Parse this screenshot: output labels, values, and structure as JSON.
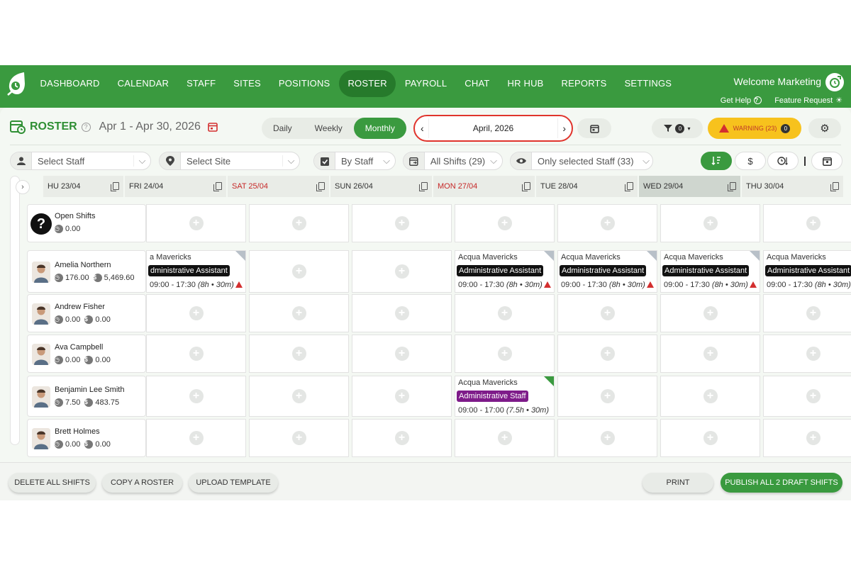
{
  "nav": {
    "items": [
      {
        "label": "DASHBOARD",
        "active": false
      },
      {
        "label": "CALENDAR",
        "active": false
      },
      {
        "label": "STAFF",
        "active": false
      },
      {
        "label": "SITES",
        "active": false
      },
      {
        "label": "POSITIONS",
        "active": false
      },
      {
        "label": "ROSTER",
        "active": true
      },
      {
        "label": "PAYROLL",
        "active": false
      },
      {
        "label": "CHAT",
        "active": false
      },
      {
        "label": "HR HUB",
        "active": false
      },
      {
        "label": "REPORTS",
        "active": false
      },
      {
        "label": "SETTINGS",
        "active": false
      }
    ],
    "welcome": "Welcome Marketing",
    "get_help": "Get Help",
    "feature_request": "Feature Request"
  },
  "header": {
    "title": "ROSTER",
    "date_range": "Apr 1 - Apr 30, 2026",
    "views": [
      "Daily",
      "Weekly",
      "Monthly"
    ],
    "active_view": "Monthly",
    "month": "April, 2026",
    "filter_count": "0",
    "warning_label": "WARNING (23)",
    "warning_count": "0"
  },
  "filters": {
    "staff_placeholder": "Select Staff",
    "site_placeholder": "Select Site",
    "group_by": "By Staff",
    "shifts": "All Shifts (29)",
    "visibility": "Only selected Staff (33)"
  },
  "days": [
    {
      "label": "HU 23/04",
      "weekend": false,
      "today": false
    },
    {
      "label": "FRI 24/04",
      "weekend": false,
      "today": false
    },
    {
      "label": "SAT 25/04",
      "weekend": true,
      "today": false
    },
    {
      "label": "SUN 26/04",
      "weekend": false,
      "today": false
    },
    {
      "label": "MON 27/04",
      "weekend": true,
      "today": false
    },
    {
      "label": "TUE 28/04",
      "weekend": false,
      "today": false
    },
    {
      "label": "WED 29/04",
      "weekend": false,
      "today": true
    },
    {
      "label": "THU 30/04",
      "weekend": false,
      "today": false
    }
  ],
  "rows": [
    {
      "name": "Open Shifts",
      "hours": "0.00",
      "cost": null,
      "type": "open"
    },
    {
      "name": "Amelia Northern",
      "hours": "176.00",
      "cost": "5,469.60",
      "type": "staff"
    },
    {
      "name": "Andrew Fisher",
      "hours": "0.00",
      "cost": "0.00",
      "type": "staff"
    },
    {
      "name": "Ava Campbell",
      "hours": "0.00",
      "cost": "0.00",
      "type": "staff"
    },
    {
      "name": "Benjamin Lee Smith",
      "hours": "7.50",
      "cost": "483.75",
      "type": "staff"
    },
    {
      "name": "Brett Holmes",
      "hours": "0.00",
      "cost": "0.00",
      "type": "staff"
    }
  ],
  "shifts": [
    {
      "row": 1,
      "col": 1,
      "site": "a Mavericks",
      "position": "dministrative Assistant",
      "time": "09:00 - 17:30",
      "dur": "(8h • 30m)",
      "status": "grey",
      "warn": true,
      "clipped": true
    },
    {
      "row": 1,
      "col": 4,
      "site": "Acqua Mavericks",
      "position": "Administrative Assistant",
      "time": "09:00 - 17:30",
      "dur": "(8h • 30m)",
      "status": "grey",
      "warn": true
    },
    {
      "row": 1,
      "col": 5,
      "site": "Acqua Mavericks",
      "position": "Administrative Assistant",
      "time": "09:00 - 17:30",
      "dur": "(8h • 30m)",
      "status": "grey",
      "warn": true
    },
    {
      "row": 1,
      "col": 6,
      "site": "Acqua Mavericks",
      "position": "Administrative Assistant",
      "time": "09:00 - 17:30",
      "dur": "(8h • 30m)",
      "status": "grey",
      "warn": true
    },
    {
      "row": 1,
      "col": 7,
      "site": "Acqua Mavericks",
      "position": "Administrative Assistant",
      "time": "09:00 - 17:30",
      "dur": "(8h • 30m)",
      "status": "grey",
      "warn": true
    },
    {
      "row": 4,
      "col": 4,
      "site": "Acqua Mavericks",
      "position": "Administrative Staff",
      "time": "09:00 - 17:00",
      "dur": "(7.5h • 30m)",
      "status": "green",
      "warn": false,
      "purple": true
    }
  ],
  "footer": {
    "delete_all": "DELETE ALL SHIFTS",
    "copy_roster": "COPY A ROSTER",
    "upload_template": "UPLOAD TEMPLATE",
    "print": "PRINT",
    "publish": "PUBLISH ALL 2 DRAFT SHIFTS"
  },
  "colors": {
    "brand": "#3a9a3f",
    "warning": "#f7c21d",
    "highlight": "#e0342c"
  }
}
